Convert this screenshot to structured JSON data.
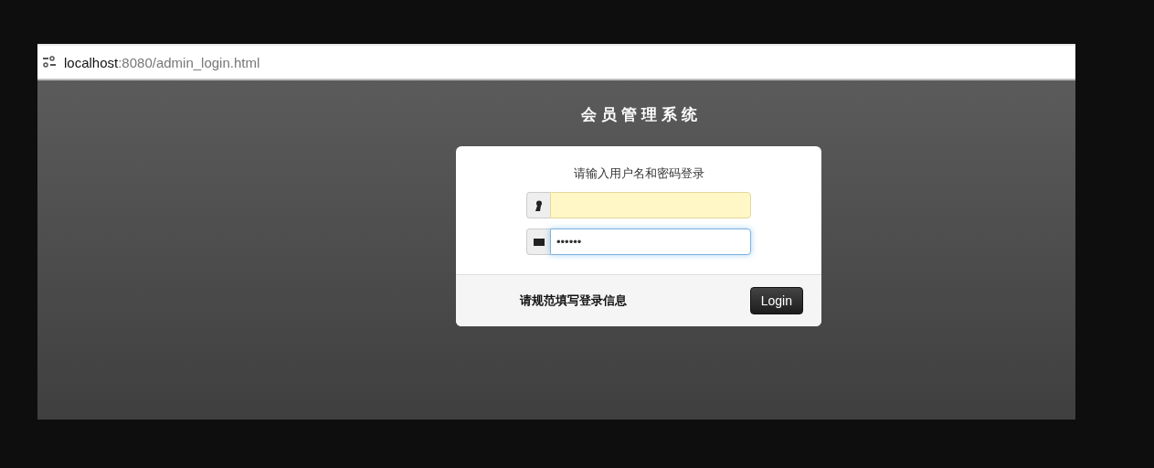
{
  "address_bar": {
    "host": "localhost",
    "path": ":8080/admin_login.html"
  },
  "page": {
    "title": "会员管理系统"
  },
  "login": {
    "prompt": "请输入用户名和密码登录",
    "fields": [
      {
        "kind": "user",
        "autofilled": true,
        "focused": false
      },
      {
        "kind": "password",
        "value": "••••••",
        "autofilled": false,
        "focused": true
      }
    ],
    "hint": "请规范填写登录信息",
    "button": "Login"
  }
}
